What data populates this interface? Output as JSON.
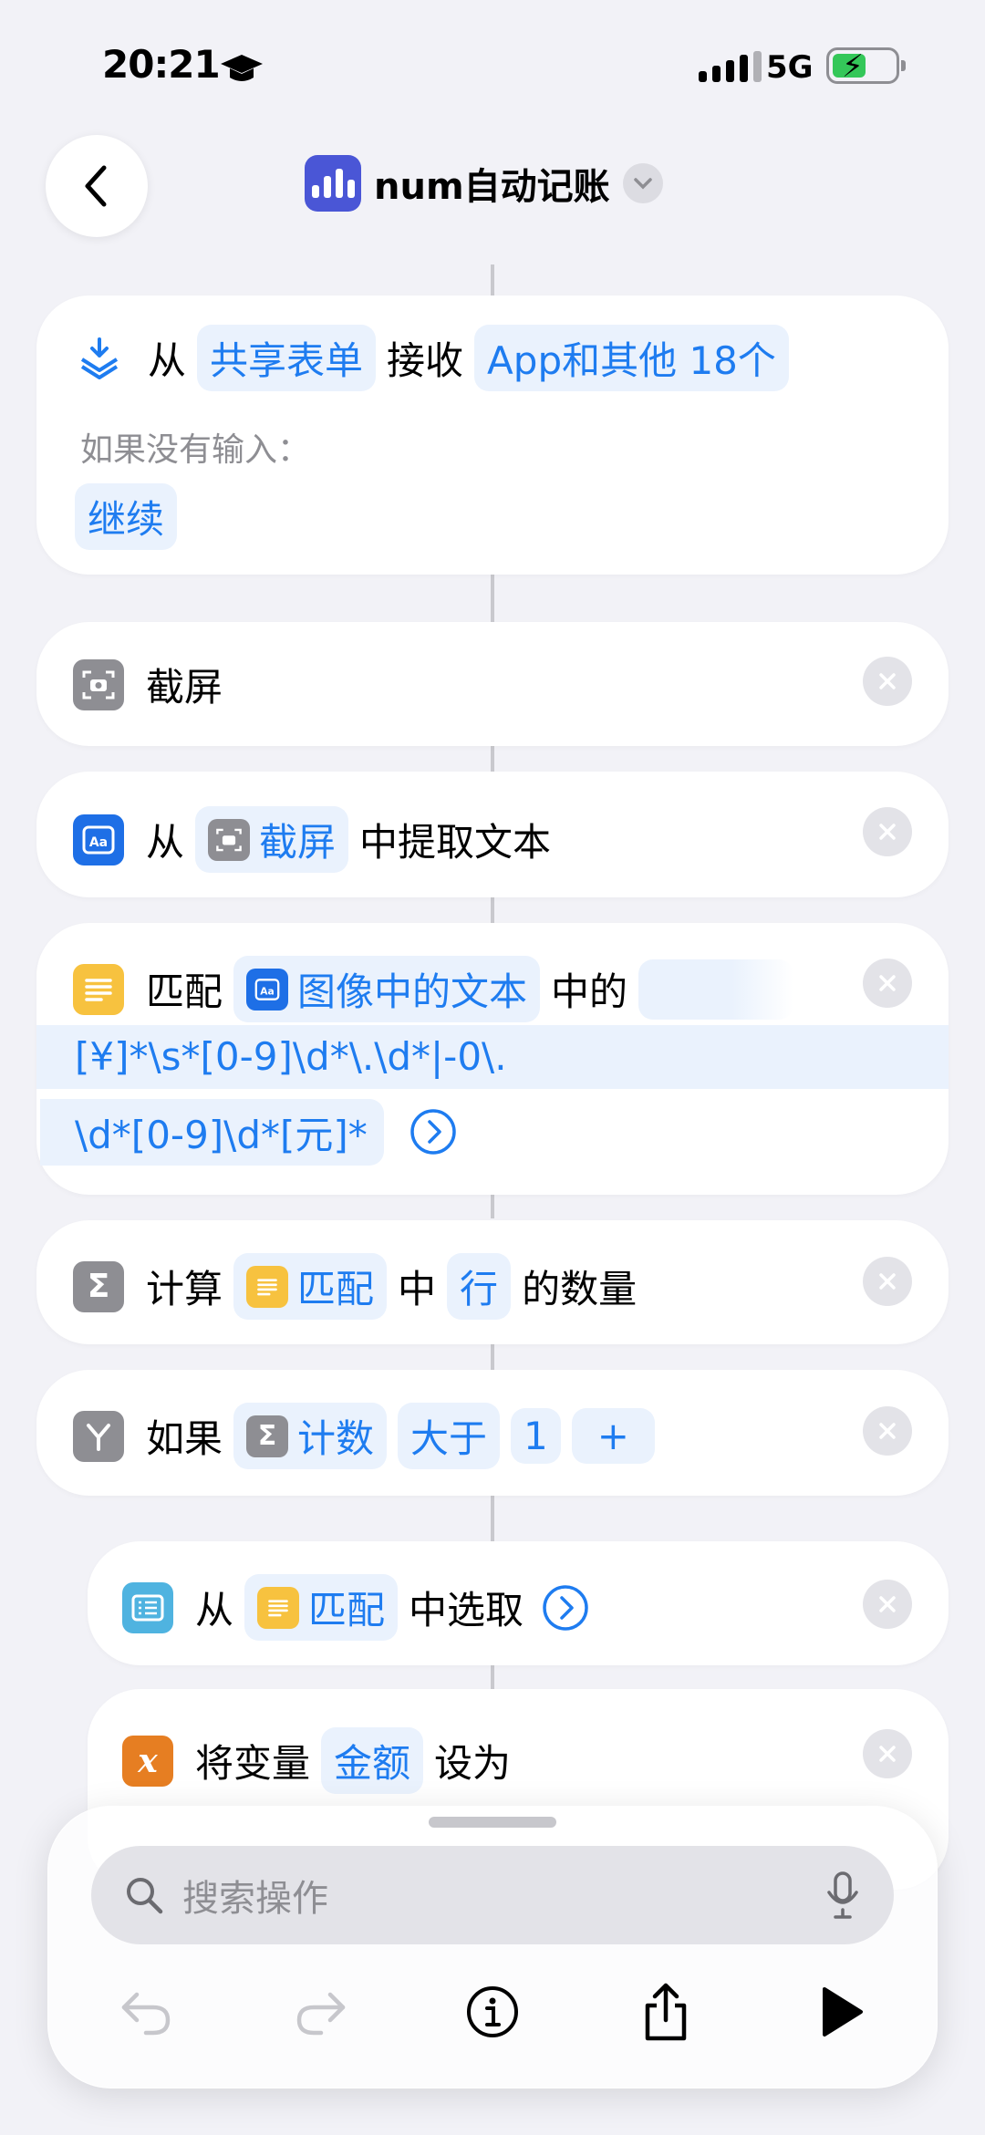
{
  "status_bar": {
    "time": "20:21",
    "network": "5G"
  },
  "nav": {
    "title": "num自动记账"
  },
  "blocks": {
    "receive": {
      "from": "从",
      "source": "共享表单",
      "receive": "接收",
      "types": "App和其他 18个",
      "no_input_label": "如果没有输入：",
      "no_input_value": "继续"
    },
    "screenshot": {
      "label": "截屏"
    },
    "extract": {
      "from": "从",
      "token": "截屏",
      "action": "中提取文本"
    },
    "match": {
      "label": "匹配",
      "token": "图像中的文本",
      "of": "中的",
      "regex_line1": "[¥]*\\s*[0-9]\\d*\\.\\d*|-0\\.",
      "regex_line2": "\\d*[0-9]\\d*[元]*"
    },
    "count": {
      "label": "计算",
      "token": "匹配",
      "in": "中",
      "unit": "行",
      "tail": "的数量"
    },
    "if": {
      "label": "如果",
      "token": "计数",
      "cond": "大于",
      "value": "1",
      "add": "+"
    },
    "get": {
      "from": "从",
      "token": "匹配",
      "action": "中选取"
    },
    "setvar": {
      "label": "将变量",
      "name": "金额",
      "to": "设为"
    }
  },
  "search": {
    "placeholder": "搜索操作"
  },
  "icons": {
    "back": "chevron-left-icon",
    "dropdown": "chevron-down-icon",
    "receive": "tray-download-icon",
    "screenshot": "camera-viewfinder-icon",
    "text": "text-aa-icon",
    "match": "text-lines-icon",
    "count": "sigma-icon",
    "if": "branch-icon",
    "list": "list-icon",
    "variable": "variable-x-icon",
    "close": "close-icon",
    "arrow": "chevron-right-circle-icon",
    "search": "search-icon",
    "mic": "microphone-icon",
    "undo": "undo-icon",
    "redo": "redo-icon",
    "info": "info-icon",
    "share": "share-icon",
    "play": "play-icon"
  },
  "colors": {
    "accent": "#1e7cf0",
    "token_bg": "#eaf2fd",
    "background": "#f2f2f7"
  }
}
